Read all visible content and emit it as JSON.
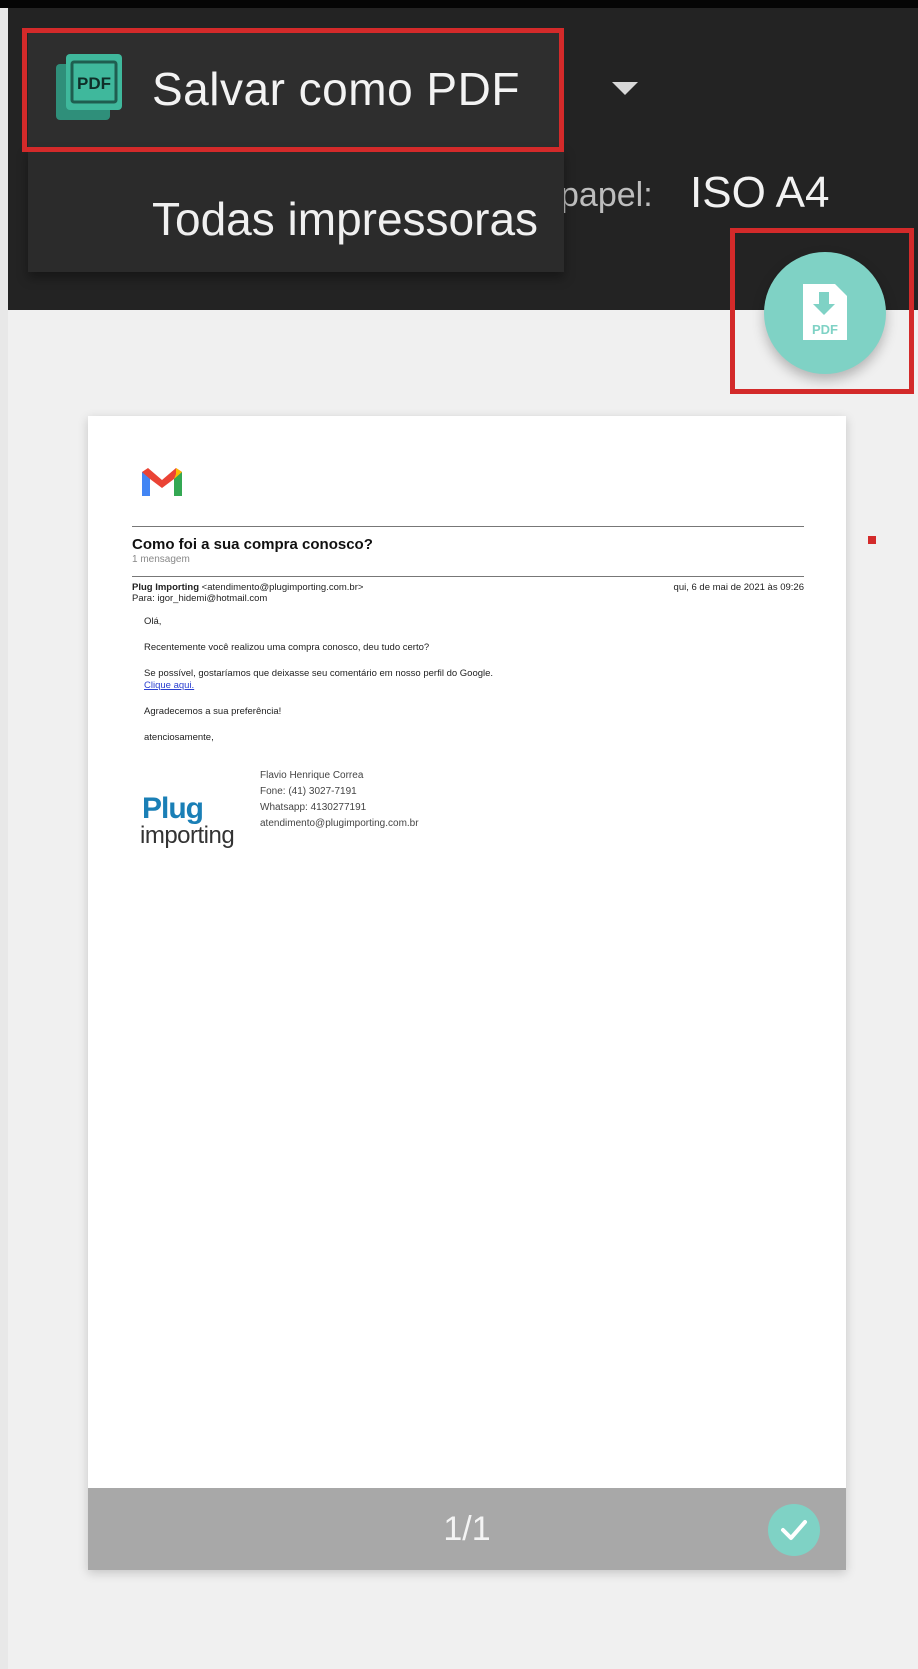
{
  "print_dialog": {
    "printer": {
      "selected_label": "Salvar como PDF",
      "icon": "pdf-file-icon",
      "options": [
        "Todas impressoras"
      ]
    },
    "paper": {
      "label_partial": "papel:",
      "value": "ISO A4"
    },
    "fab": {
      "icon": "pdf-download-icon",
      "icon_text": "PDF"
    },
    "accent_color": "#7fd2c5",
    "highlight_color": "#d32a2a"
  },
  "preview": {
    "page_counter": "1/1",
    "selected": true
  },
  "email": {
    "subject": "Como foi a sua compra conosco?",
    "message_count": "1 mensagem",
    "sender_name": "Plug Importing",
    "sender_email": "<atendimento@plugimporting.com.br>",
    "date": "qui, 6 de mai de 2021 às 09:26",
    "to": "Para: igor_hidemi@hotmail.com",
    "body": {
      "greeting": "Olá,",
      "line1": "Recentemente você realizou uma compra conosco, deu tudo certo?",
      "line2": "Se possível, gostaríamos que deixasse seu comentário em nosso perfil do Google.",
      "link": "Clique aqui.",
      "line3": "Agradecemos a sua preferência!",
      "closing": "atenciosamente,"
    },
    "signature": {
      "logo_plug": "Plug",
      "logo_importing": "importing",
      "name": "Flavio Henrique Correa",
      "phone": "Fone: (41) 3027-7191",
      "whatsapp": "Whatsapp: 4130277191",
      "email": "atendimento@plugimporting.com.br"
    }
  }
}
